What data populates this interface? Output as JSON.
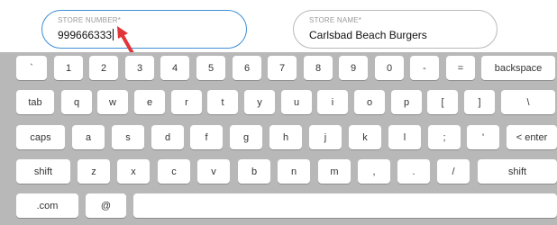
{
  "fields": {
    "store_number": {
      "label": "STORE NUMBER*",
      "value": "999666333"
    },
    "store_name": {
      "label": "STORE NAME*",
      "value": "Carlsbad Beach Burgers"
    }
  },
  "colors": {
    "focus_border": "#3f8ed4",
    "keyboard_bg": "#b8b8b8",
    "pointer": "#e0353a"
  },
  "keyboard": {
    "rows": [
      [
        {
          "label": "`",
          "name": "backtick"
        },
        {
          "label": "1",
          "name": "1"
        },
        {
          "label": "2",
          "name": "2"
        },
        {
          "label": "3",
          "name": "3"
        },
        {
          "label": "4",
          "name": "4"
        },
        {
          "label": "5",
          "name": "5"
        },
        {
          "label": "6",
          "name": "6"
        },
        {
          "label": "7",
          "name": "7"
        },
        {
          "label": "8",
          "name": "8"
        },
        {
          "label": "9",
          "name": "9"
        },
        {
          "label": "0",
          "name": "0"
        },
        {
          "label": "-",
          "name": "minus"
        },
        {
          "label": "=",
          "name": "equals"
        },
        {
          "label": "backspace",
          "name": "backspace"
        }
      ],
      [
        {
          "label": "tab",
          "name": "tab"
        },
        {
          "label": "q",
          "name": "q"
        },
        {
          "label": "w",
          "name": "w"
        },
        {
          "label": "e",
          "name": "e"
        },
        {
          "label": "r",
          "name": "r"
        },
        {
          "label": "t",
          "name": "t"
        },
        {
          "label": "y",
          "name": "y"
        },
        {
          "label": "u",
          "name": "u"
        },
        {
          "label": "i",
          "name": "i"
        },
        {
          "label": "o",
          "name": "o"
        },
        {
          "label": "p",
          "name": "p"
        },
        {
          "label": "[",
          "name": "left-bracket"
        },
        {
          "label": "]",
          "name": "right-bracket"
        },
        {
          "label": "\\",
          "name": "backslash"
        }
      ],
      [
        {
          "label": "caps",
          "name": "caps"
        },
        {
          "label": "a",
          "name": "a"
        },
        {
          "label": "s",
          "name": "s"
        },
        {
          "label": "d",
          "name": "d"
        },
        {
          "label": "f",
          "name": "f"
        },
        {
          "label": "g",
          "name": "g"
        },
        {
          "label": "h",
          "name": "h"
        },
        {
          "label": "j",
          "name": "j"
        },
        {
          "label": "k",
          "name": "k"
        },
        {
          "label": "l",
          "name": "l"
        },
        {
          "label": ";",
          "name": "semicolon"
        },
        {
          "label": "'",
          "name": "quote"
        },
        {
          "label": "< enter",
          "name": "enter"
        }
      ],
      [
        {
          "label": "shift",
          "name": "shift-left"
        },
        {
          "label": "z",
          "name": "z"
        },
        {
          "label": "x",
          "name": "x"
        },
        {
          "label": "c",
          "name": "c"
        },
        {
          "label": "v",
          "name": "v"
        },
        {
          "label": "b",
          "name": "b"
        },
        {
          "label": "n",
          "name": "n"
        },
        {
          "label": "m",
          "name": "m"
        },
        {
          "label": ",",
          "name": "comma"
        },
        {
          "label": ".",
          "name": "period"
        },
        {
          "label": "/",
          "name": "slash"
        },
        {
          "label": "shift",
          "name": "shift-right"
        }
      ],
      [
        {
          "label": ".com",
          "name": "dotcom"
        },
        {
          "label": "@",
          "name": "at"
        },
        {
          "label": "",
          "name": "space"
        }
      ]
    ]
  }
}
